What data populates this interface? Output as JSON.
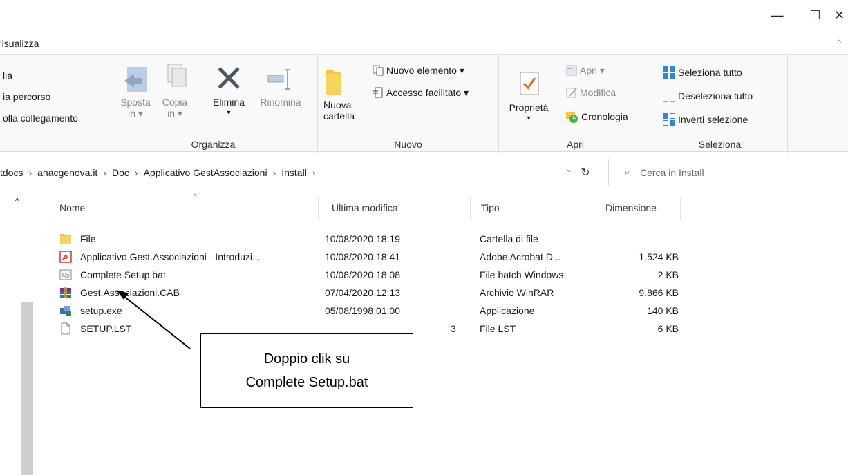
{
  "window": {
    "minimize": "—",
    "maximize": "☐",
    "close": "✕"
  },
  "menu": {
    "tab_label": "'isualizza",
    "collapse": "^"
  },
  "ribbon": {
    "clipboard": {
      "item1": "lia",
      "item2": "ia percorso",
      "item3": "olla collegamento"
    },
    "organize": {
      "label": "Organizza",
      "move_l1": "Sposta",
      "move_l2": "in ▾",
      "copy_l1": "Copia",
      "copy_l2": "in ▾",
      "delete": "Elimina",
      "delete_arrow": "▾",
      "rename": "Rinomina"
    },
    "new": {
      "label": "Nuovo",
      "new_folder_l1": "Nuova",
      "new_folder_l2": "cartella",
      "new_item": "Nuovo elemento ▾",
      "easy_access": "Accesso facilitato ▾"
    },
    "open": {
      "label": "Apri",
      "properties": "Proprietà",
      "properties_arrow": "▾",
      "open": "Apri ▾",
      "edit": "Modifica",
      "history": "Cronologia"
    },
    "select": {
      "label": "Seleziona",
      "select_all": "Seleziona tutto",
      "select_none": "Deseleziona tutto",
      "invert": "Inverti selezione"
    }
  },
  "address": {
    "crumbs": [
      "tdocs",
      "anacgenova.it",
      "Doc",
      "Applicativo GestAssociazioni",
      "Install"
    ],
    "sep": "›",
    "dropdown": "⌄",
    "refresh": "↻"
  },
  "search": {
    "placeholder": "Cerca in Install",
    "icon": "⌕"
  },
  "columns": {
    "name": "Nome",
    "modified": "Ultima modifica",
    "type": "Tipo",
    "size": "Dimensione",
    "sort": "^"
  },
  "files": [
    {
      "icon": "folder-icon",
      "name": "File",
      "date": "10/08/2020 18:19",
      "type": "Cartella di file",
      "size": ""
    },
    {
      "icon": "pdf-icon",
      "name": "Applicativo Gest.Associazioni - Introduzi...",
      "date": "10/08/2020 18:41",
      "type": "Adobe Acrobat D...",
      "size": "1.524 KB"
    },
    {
      "icon": "batch-icon",
      "name": "Complete Setup.bat",
      "date": "10/08/2020 18:08",
      "type": "File batch Windows",
      "size": "2 KB"
    },
    {
      "icon": "winrar-icon",
      "name": "Gest.Associazioni.CAB",
      "date": "07/04/2020 12:13",
      "type": "Archivio WinRAR",
      "size": "9.866 KB"
    },
    {
      "icon": "setup-exe-icon",
      "name": "setup.exe",
      "date": "05/08/1998 01:00",
      "type": "Applicazione",
      "size": "140 KB"
    },
    {
      "icon": "file-icon",
      "name": "SETUP.LST",
      "date": "3",
      "type": "File LST",
      "size": "6 KB"
    }
  ],
  "annotation": {
    "line1": "Doppio clik su",
    "line2": "Complete Setup.bat"
  },
  "sidebar": {
    "up": "^"
  }
}
